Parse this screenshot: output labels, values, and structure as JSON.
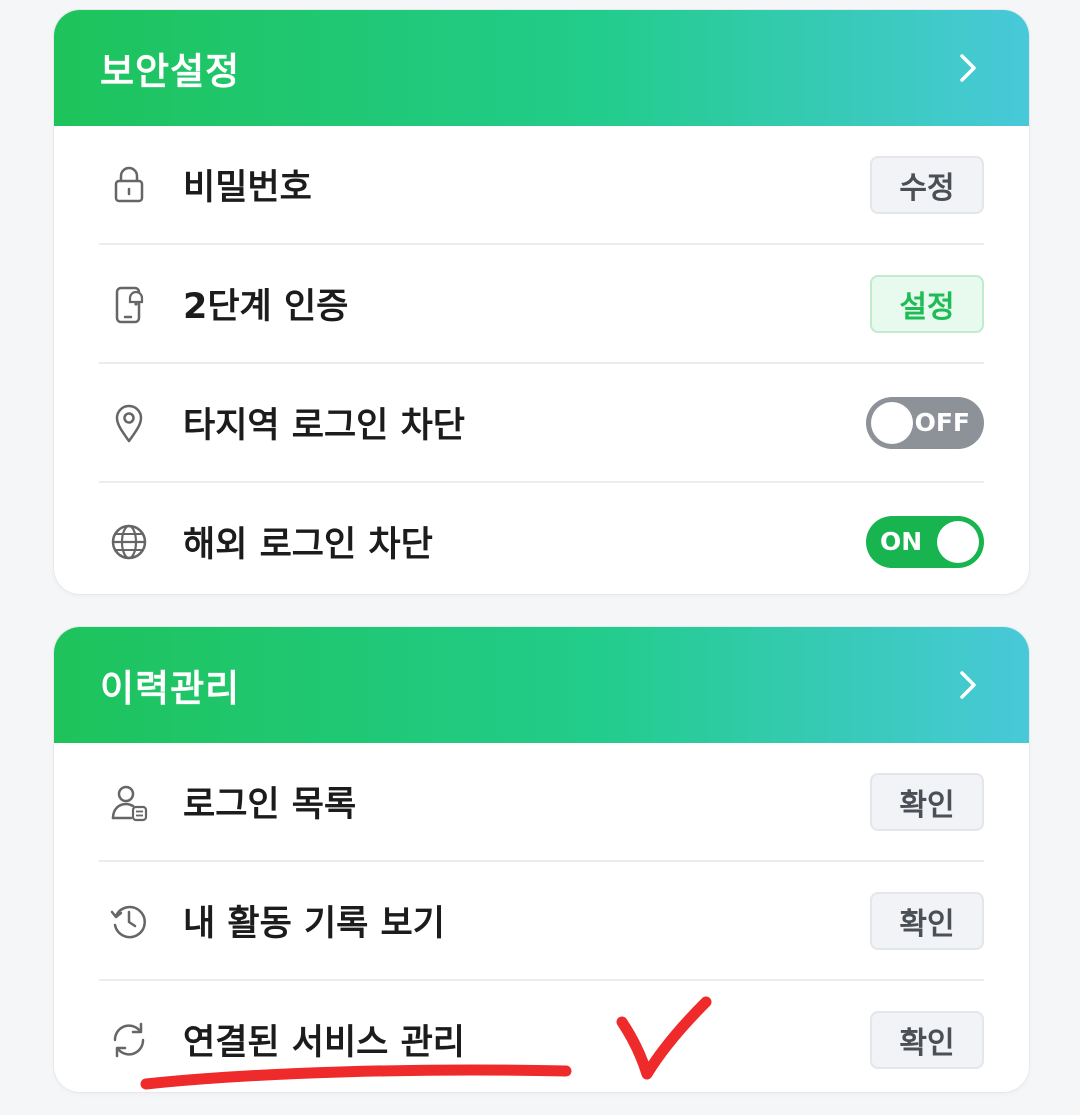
{
  "security": {
    "title": "보안설정",
    "items": [
      {
        "icon": "lock-icon",
        "label": "비밀번호",
        "action": "수정"
      },
      {
        "icon": "phone-bell-icon",
        "label": "2단계 인증",
        "action": "설정"
      },
      {
        "icon": "location-pin-icon",
        "label": "타지역 로그인 차단",
        "toggle": "OFF"
      },
      {
        "icon": "globe-icon",
        "label": "해외 로그인 차단",
        "toggle": "ON"
      }
    ]
  },
  "history": {
    "title": "이력관리",
    "items": [
      {
        "icon": "user-list-icon",
        "label": "로그인 목록",
        "action": "확인"
      },
      {
        "icon": "history-clock-icon",
        "label": "내 활동 기록 보기",
        "action": "확인"
      },
      {
        "icon": "sync-icon",
        "label": "연결된 서비스 관리",
        "action": "확인"
      }
    ]
  },
  "colors": {
    "header_gradient_start": "#1ec35b",
    "header_gradient_end": "#48c9d9",
    "toggle_on": "#17b450",
    "toggle_off": "#8d9299",
    "annotation": "#ef2a2a"
  }
}
